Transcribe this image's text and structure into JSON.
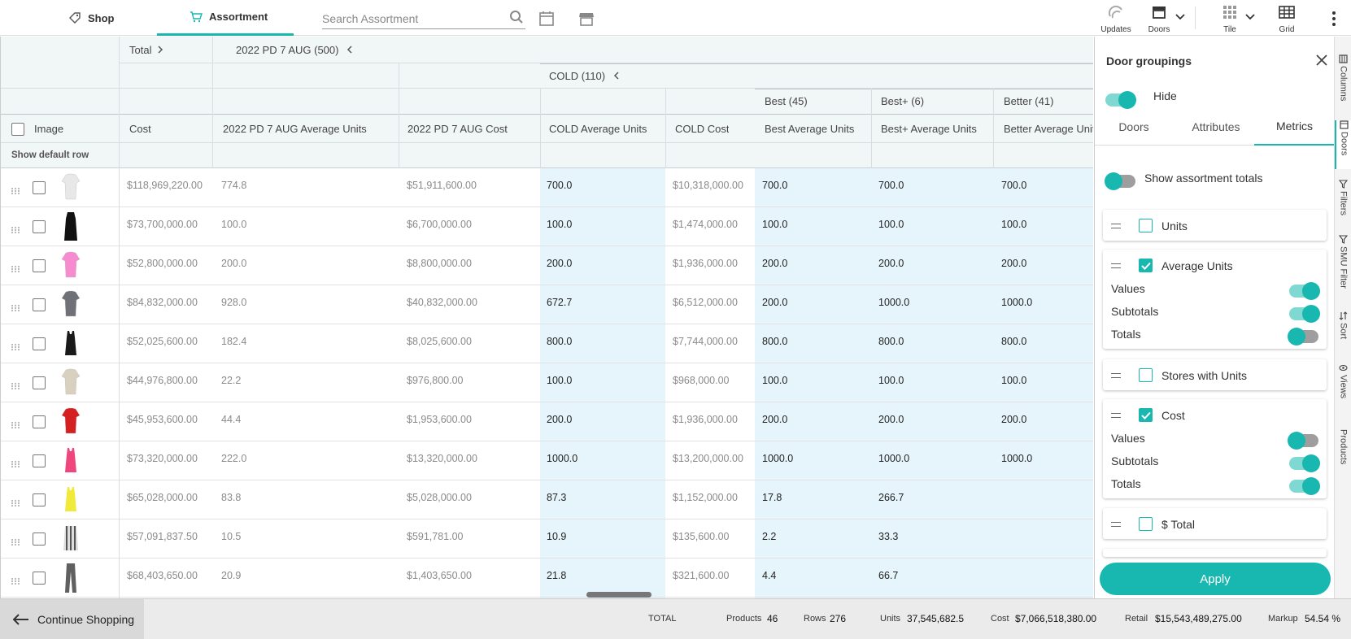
{
  "topbar": {
    "tabs": [
      {
        "label": "Shop",
        "icon": "tag-icon"
      },
      {
        "label": "Assortment",
        "icon": "cart-icon"
      }
    ],
    "search_placeholder": "Search Assortment",
    "right_items": [
      {
        "label": "Updates",
        "icon": "updates-icon"
      },
      {
        "label": "Doors",
        "icon": "store-icon"
      },
      {
        "label": "Tile",
        "icon": "tile-icon"
      },
      {
        "label": "Grid",
        "icon": "grid-icon"
      }
    ]
  },
  "grid": {
    "group_row1": {
      "total": "Total",
      "period": "2022 PD 7 AUG (500)"
    },
    "group_row2": {
      "cold": "COLD (110)"
    },
    "group_row3": {
      "best": "Best (45)",
      "bestplus": "Best+ (6)",
      "better": "Better (41)"
    },
    "columns": [
      "Image",
      "Cost",
      "2022 PD 7 AUG Average Units",
      "2022 PD 7 AUG Cost",
      "COLD Average Units",
      "COLD Cost",
      "Best Average Units",
      "Best+ Average Units",
      "Better Average Units"
    ],
    "default_row_label": "Show default row",
    "rows": [
      {
        "product": "white-top",
        "color": "#e8e8e8",
        "cost": "$118,969,220.00",
        "pd_units": "774.8",
        "pd_cost": "$51,911,600.00",
        "cold_units": "700.0",
        "cold_cost": "$10,318,000.00",
        "best": "700.0",
        "bestplus": "700.0",
        "better": "700.0"
      },
      {
        "product": "black-dress",
        "color": "#111111",
        "cost": "$73,700,000.00",
        "pd_units": "100.0",
        "pd_cost": "$6,700,000.00",
        "cold_units": "100.0",
        "cold_cost": "$1,474,000.00",
        "best": "100.0",
        "bestplus": "100.0",
        "better": "100.0"
      },
      {
        "product": "pink-top",
        "color": "#f78bd0",
        "cost": "$52,800,000.00",
        "pd_units": "200.0",
        "pd_cost": "$8,800,000.00",
        "cold_units": "200.0",
        "cold_cost": "$1,936,000.00",
        "best": "200.0",
        "bestplus": "200.0",
        "better": "200.0"
      },
      {
        "product": "grey-top",
        "color": "#707078",
        "cost": "$84,832,000.00",
        "pd_units": "928.0",
        "pd_cost": "$40,832,000.00",
        "cold_units": "672.7",
        "cold_cost": "$6,512,000.00",
        "best": "200.0",
        "bestplus": "1000.0",
        "better": "1000.0"
      },
      {
        "product": "black-tank",
        "color": "#1a1a1a",
        "cost": "$52,025,600.00",
        "pd_units": "182.4",
        "pd_cost": "$8,025,600.00",
        "cold_units": "800.0",
        "cold_cost": "$7,744,000.00",
        "best": "800.0",
        "bestplus": "800.0",
        "better": "800.0"
      },
      {
        "product": "beige-top",
        "color": "#d9d0c0",
        "cost": "$44,976,800.00",
        "pd_units": "22.2",
        "pd_cost": "$976,800.00",
        "cold_units": "100.0",
        "cold_cost": "$968,000.00",
        "best": "100.0",
        "bestplus": "100.0",
        "better": "100.0"
      },
      {
        "product": "red-top",
        "color": "#d42020",
        "cost": "$45,953,600.00",
        "pd_units": "44.4",
        "pd_cost": "$1,953,600.00",
        "cold_units": "200.0",
        "cold_cost": "$1,936,000.00",
        "best": "200.0",
        "bestplus": "200.0",
        "better": "200.0"
      },
      {
        "product": "hot-pink-tank",
        "color": "#f0467e",
        "cost": "$73,320,000.00",
        "pd_units": "222.0",
        "pd_cost": "$13,320,000.00",
        "cold_units": "1000.0",
        "cold_cost": "$13,200,000.00",
        "best": "1000.0",
        "bestplus": "1000.0",
        "better": "1000.0"
      },
      {
        "product": "yellow-tank",
        "color": "#f2ea3a",
        "cost": "$65,028,000.00",
        "pd_units": "83.8",
        "pd_cost": "$5,028,000.00",
        "cold_units": "87.3",
        "cold_cost": "$1,152,000.00",
        "best": "17.8",
        "bestplus": "266.7",
        "better": ""
      },
      {
        "product": "striped-top",
        "color": "#555555",
        "cost": "$57,091,837.50",
        "pd_units": "10.5",
        "pd_cost": "$591,781.00",
        "cold_units": "10.9",
        "cold_cost": "$135,600.00",
        "best": "2.2",
        "bestplus": "33.3",
        "better": ""
      },
      {
        "product": "grey-pants",
        "color": "#606060",
        "cost": "$68,403,650.00",
        "pd_units": "20.9",
        "pd_cost": "$1,403,650.00",
        "cold_units": "21.8",
        "cold_cost": "$321,600.00",
        "best": "4.4",
        "bestplus": "66.7",
        "better": ""
      }
    ]
  },
  "panel": {
    "title": "Door groupings",
    "hide_label": "Hide",
    "tabs": [
      "Doors",
      "Attributes",
      "Metrics"
    ],
    "show_totals_label": "Show assortment totals",
    "metrics": [
      {
        "label": "Units",
        "checked": false
      },
      {
        "label": "Average Units",
        "checked": true,
        "values": "Values",
        "subtotals": "Subtotals",
        "totals": "Totals"
      },
      {
        "label": "Stores with Units",
        "checked": false
      },
      {
        "label": "Cost",
        "checked": true,
        "values": "Values",
        "subtotals": "Subtotals",
        "totals": "Totals"
      },
      {
        "label": "$ Total",
        "checked": false
      }
    ],
    "apply_label": "Apply"
  },
  "side_tabs": [
    "Columns",
    "Doors",
    "Filters",
    "SMU Filter",
    "Sort",
    "Views",
    "Products"
  ],
  "footer": {
    "continue_label": "Continue Shopping",
    "total_label": "TOTAL",
    "products_label": "Products",
    "products_value": "46",
    "rows_label": "Rows",
    "rows_value": "276",
    "units_label": "Units",
    "units_value": "37,545,682.5",
    "cost_label": "Cost",
    "cost_value": "$7,066,518,380.00",
    "retail_label": "Retail",
    "retail_value": "$15,543,489,275.00",
    "markup_label": "Markup",
    "markup_value": "54.54 %"
  },
  "colors": {
    "accent": "#18b7b0"
  }
}
